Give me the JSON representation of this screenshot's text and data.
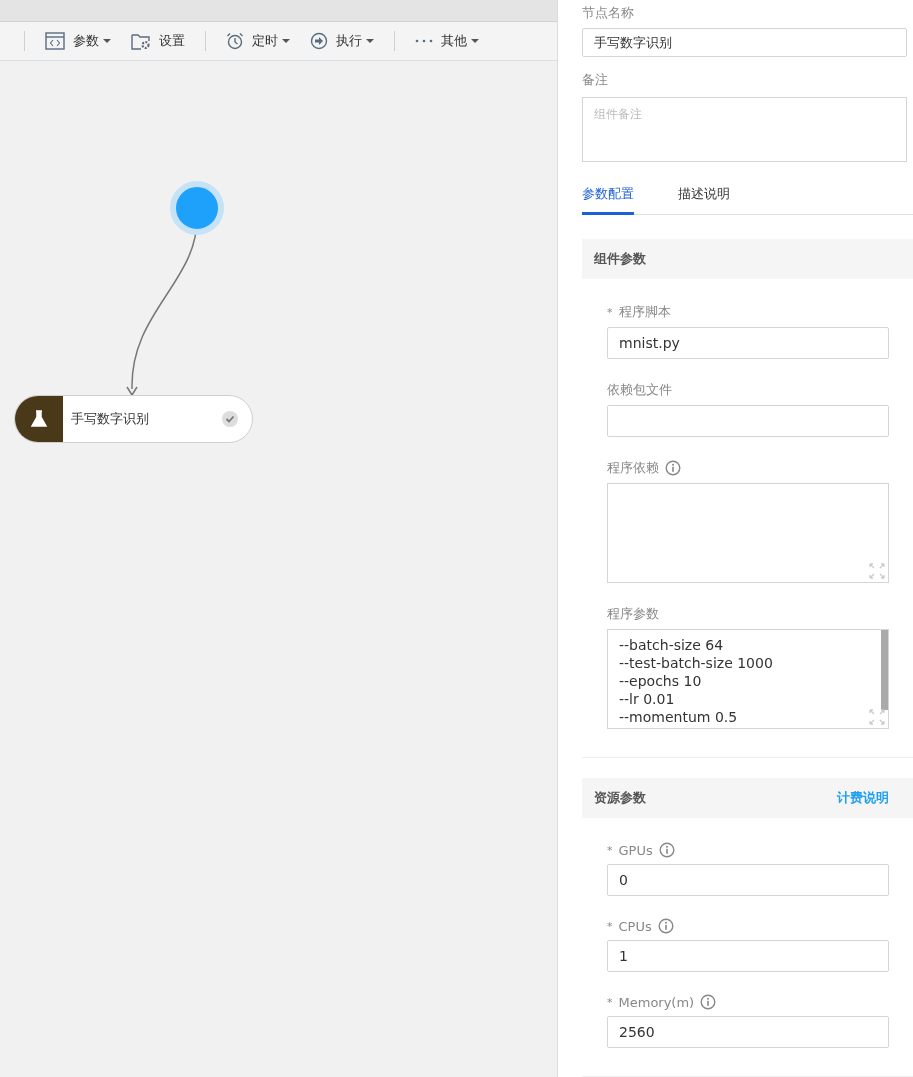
{
  "toolbar": [
    {
      "label": "参数",
      "dropdown": true,
      "separator_before": true
    },
    {
      "label": "设置",
      "dropdown": false,
      "separator_before": false
    },
    {
      "label": "定时",
      "dropdown": true,
      "separator_before": true
    },
    {
      "label": "执行",
      "dropdown": true,
      "separator_before": false
    },
    {
      "label": "其他",
      "dropdown": true,
      "separator_before": true
    }
  ],
  "canvas": {
    "node": {
      "label": "手写数字识别",
      "done": true
    }
  },
  "panel": {
    "name_label": "节点名称",
    "name_value": "手写数字识别",
    "note_label": "备注",
    "note_placeholder": "组件备注",
    "tabs": [
      {
        "label": "参数配置",
        "selected": true
      },
      {
        "label": "描述说明",
        "selected": false
      }
    ],
    "sections": [
      {
        "title": "组件参数",
        "fields": [
          {
            "kind": "input",
            "required_mark": "*",
            "label": "程序脚本",
            "info": false,
            "value": "mnist.py"
          },
          {
            "kind": "input",
            "label": "依赖包文件",
            "info": false
          },
          {
            "kind": "textarea",
            "label": "程序依赖",
            "info": true
          },
          {
            "kind": "textarea",
            "label": "程序参数",
            "info": false,
            "lines": [
              "--batch-size 64",
              "--test-batch-size 1000",
              "--epochs 10",
              "--lr 0.01",
              "--momentum 0.5"
            ]
          }
        ]
      },
      {
        "title": "资源参数",
        "link": "计费说明",
        "fields": [
          {
            "kind": "input",
            "required_mark": "*",
            "label": "GPUs",
            "info": true,
            "value": "0"
          },
          {
            "kind": "input",
            "required_mark": "*",
            "label": "CPUs",
            "info": true,
            "value": "1"
          },
          {
            "kind": "input",
            "required_mark": "*",
            "label": "Memory(m)",
            "info": true,
            "value": "2560"
          }
        ]
      }
    ]
  }
}
